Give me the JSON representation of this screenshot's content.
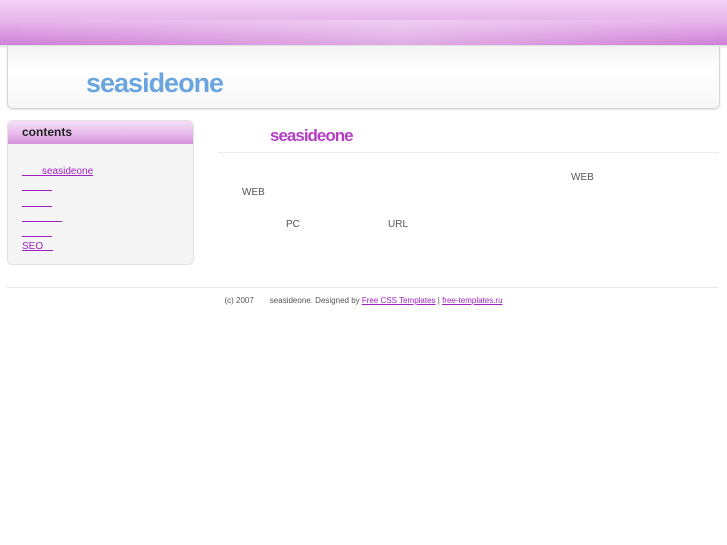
{
  "header": {
    "site_name": "seasideone"
  },
  "sidebar": {
    "title": "contents",
    "links": [
      "　　seasideone",
      "　　　",
      "　　　",
      "　　　　",
      "　　　",
      "SEO　"
    ]
  },
  "main": {
    "title": "seasideone",
    "text_web_1": "WEB",
    "text_web_2": "WEB",
    "text_pc": "PC",
    "text_url": "URL"
  },
  "footer": {
    "copyright": "(c) 2007　　seasideone. Designed by ",
    "link_1": "Free CSS Templates",
    "separator": " | ",
    "link_2": "free-templates.ru"
  },
  "colors": {
    "brand_blue": "#6aa6dd",
    "accent_purple": "#b43fc4",
    "link_purple": "#a020c0",
    "top_bar": "#cf7fd6"
  }
}
